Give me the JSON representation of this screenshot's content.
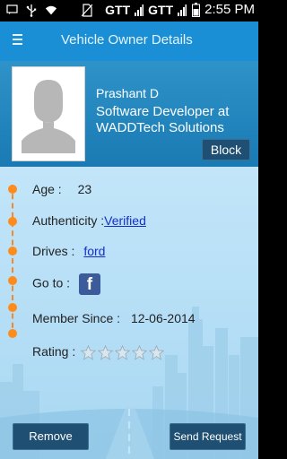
{
  "status_bar": {
    "carrier_1": "GTT",
    "carrier_2": "GTT",
    "time": "2:55 PM",
    "icons": [
      "sms-icon",
      "usb-icon",
      "wifi-icon",
      "no-sim-icon",
      "signal-icon",
      "battery-icon"
    ]
  },
  "app_bar": {
    "title": "Vehicle Owner Details",
    "menu_icon": "menu-icon"
  },
  "profile": {
    "name": "Prashant D",
    "job_line_1": "Software Developer at",
    "job_line_2": "WADDTech Solutions",
    "block_label": "Block"
  },
  "details": {
    "age_label": "Age :",
    "age_value": "23",
    "auth_label": "Authenticity :",
    "auth_value": "Verified",
    "drives_label": "Drives :",
    "drives_value": "ford",
    "goto_label": "Go to :",
    "goto_icon": "facebook-icon",
    "member_label": "Member Since :",
    "member_value": "12-06-2014",
    "rating_label": "Rating :",
    "rating_value": 0,
    "rating_max": 5
  },
  "actions": {
    "remove_label": "Remove",
    "send_label": "Send Request"
  },
  "colors": {
    "app_bar": "#1a8fd6",
    "header": "#2e93c9",
    "timeline": "#ff8c1a",
    "button": "#1f4f72",
    "link": "#1530c9"
  }
}
